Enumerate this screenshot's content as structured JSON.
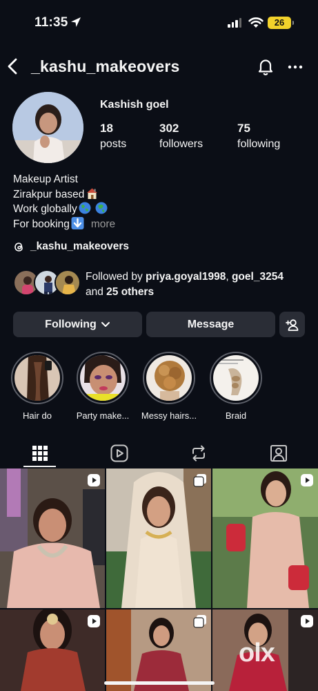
{
  "status_bar": {
    "time": "11:35",
    "battery": "26"
  },
  "header": {
    "username": "_kashu_makeovers"
  },
  "profile": {
    "name": "Kashish goel",
    "stats": [
      {
        "value": "18",
        "label": "posts"
      },
      {
        "value": "302",
        "label": "followers"
      },
      {
        "value": "75",
        "label": "following"
      }
    ],
    "bio": [
      "Makeup Artist",
      "Zirakpur based",
      "Work globally",
      "For booking"
    ],
    "bio_more": "more",
    "threads_handle": "_kashu_makeovers"
  },
  "followed_by": {
    "prefix": "Followed by ",
    "user1": "priya.goyal1998",
    "sep": ", ",
    "user2": "goel_3254",
    "and": "and ",
    "others": "25 others"
  },
  "actions": {
    "following": "Following",
    "message": "Message"
  },
  "highlights": [
    {
      "label": "Hair do"
    },
    {
      "label": "Party make..."
    },
    {
      "label": "Messy hairs..."
    },
    {
      "label": "Braid"
    }
  ],
  "tabs": [
    "grid-icon",
    "reels-icon",
    "reposts-icon",
    "tagged-icon"
  ],
  "watermark": "olx",
  "colors": {
    "background": "#0b0e16",
    "button": "#2a2d36",
    "battery": "#f2d22b",
    "muted": "#9a9a9a"
  }
}
